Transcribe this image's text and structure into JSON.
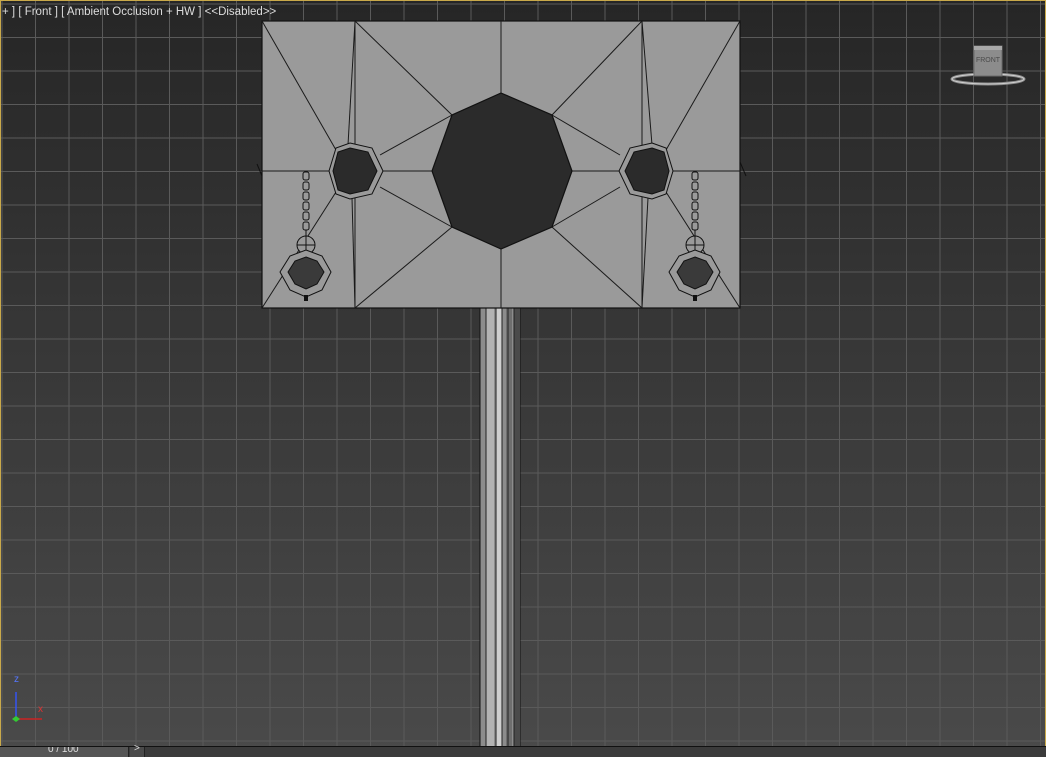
{
  "viewport": {
    "label_plus": "+ ]",
    "label_view": "[ Front ]",
    "label_shading": "[ Ambient Occlusion + HW ]",
    "label_status": "<<Disabled>>"
  },
  "viewcube": {
    "face_label": "FRONT",
    "icon": "viewcube-icon"
  },
  "axis": {
    "z_label": "z",
    "x_label": "x",
    "icon": "axis-tripod-icon"
  },
  "timeline": {
    "frame_readout": "0 / 100",
    "next_glyph": ">"
  },
  "colors": {
    "viewport_border": "#c9a94a",
    "mesh_face": "#9a9a9a",
    "mesh_dark": "#2b2b2b",
    "grid_line": "#5a5a5a",
    "axis_x": "#cc2222",
    "axis_z": "#3355ff"
  }
}
